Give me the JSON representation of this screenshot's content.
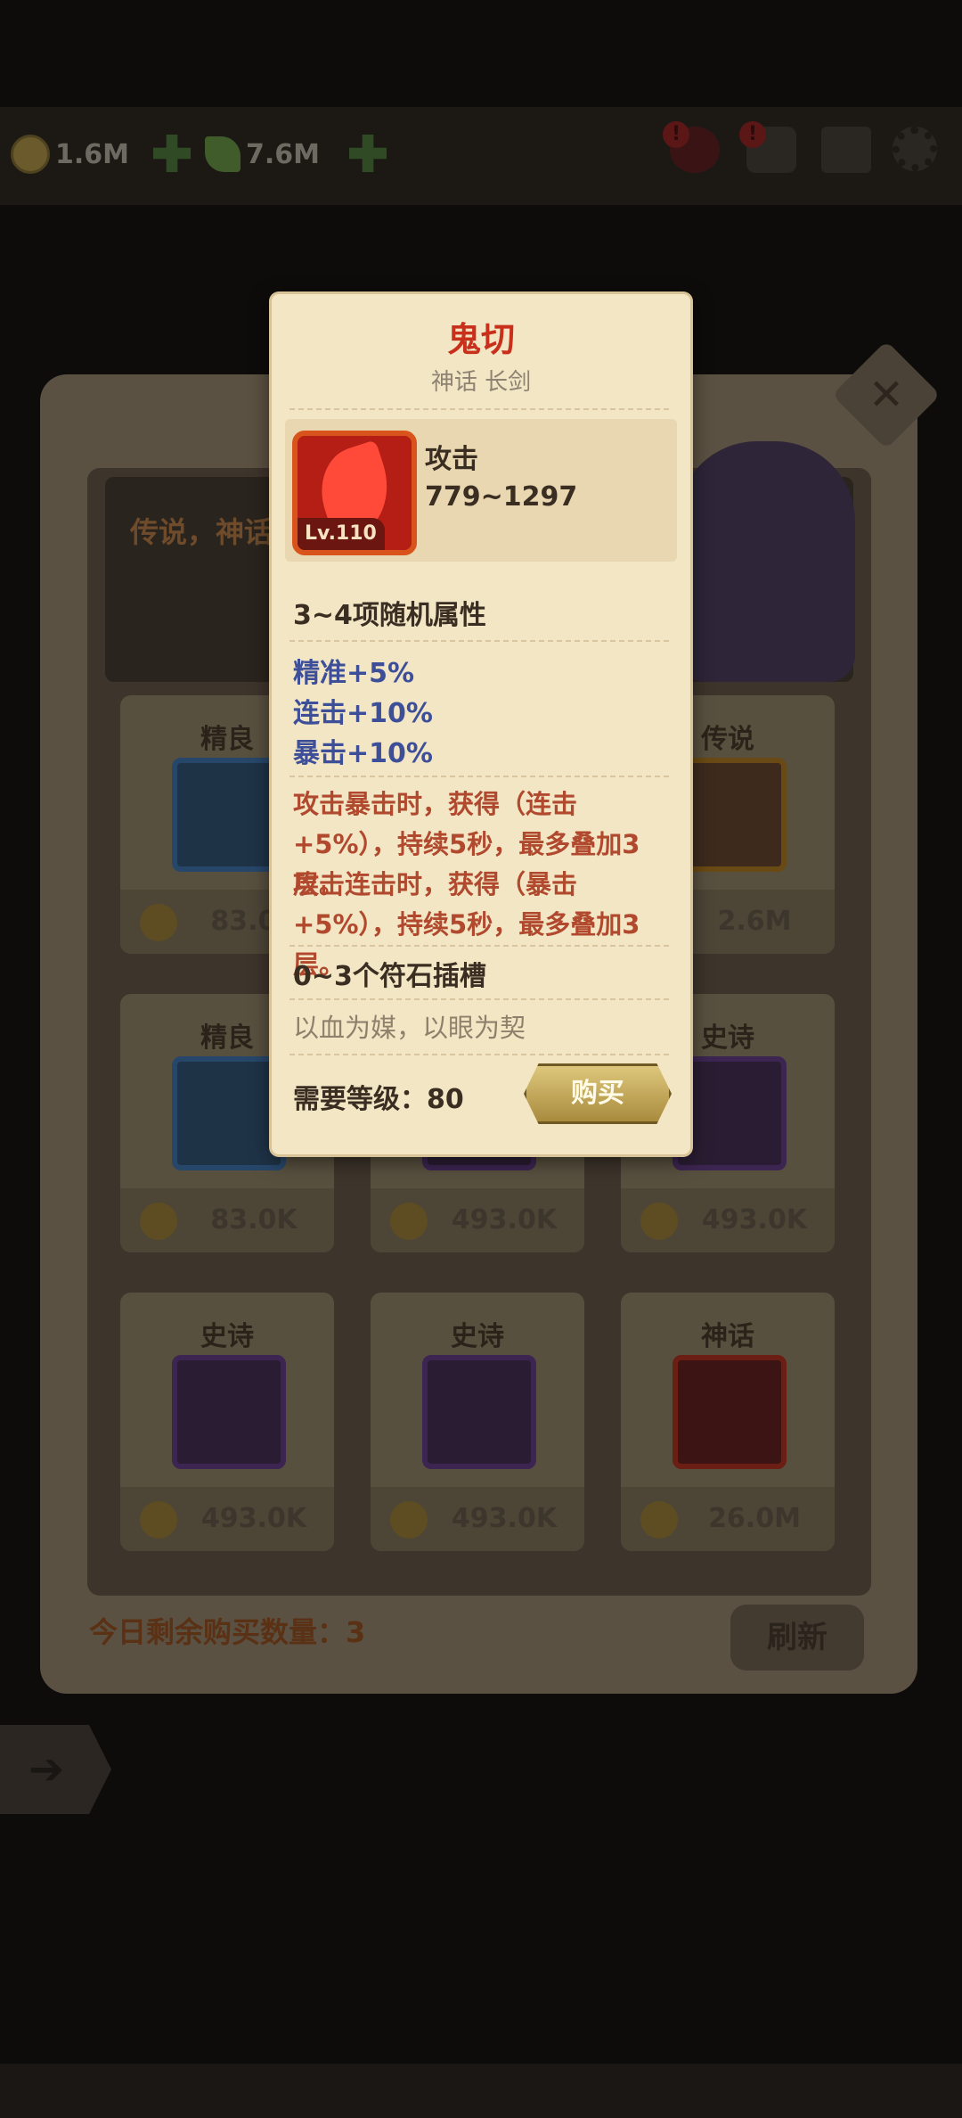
{
  "topbar": {
    "gold_amount": "1.6M",
    "gem_amount": "7.6M",
    "alert_marks": [
      "!",
      "!"
    ]
  },
  "shop": {
    "banner_text": "传说，神话",
    "close_icon_glyph": "✕",
    "items": [
      {
        "tier": "精良",
        "price": "83.0K",
        "rarity": "blue"
      },
      {
        "tier": "传说",
        "price": "2.6M",
        "rarity": "orange"
      },
      {
        "tier": "精良",
        "price": "83.0K",
        "rarity": "blue"
      },
      {
        "tier": "",
        "price": "493.0K",
        "rarity": "purple"
      },
      {
        "tier": "史诗",
        "price": "493.0K",
        "rarity": "purple"
      },
      {
        "tier": "史诗",
        "price": "493.0K",
        "rarity": "purple"
      },
      {
        "tier": "史诗",
        "price": "493.0K",
        "rarity": "purple"
      },
      {
        "tier": "神话",
        "price": "26.0M",
        "rarity": "red"
      }
    ],
    "remaining_label": "今日剩余购买数量：3",
    "refresh_label": "刷新"
  },
  "popup": {
    "title": "鬼切",
    "subtitle": "神话 长剑",
    "level_badge": "Lv.110",
    "stat_name": "攻击",
    "stat_value": "779~1297",
    "random_attr_header": "3~4项随机属性",
    "attributes": [
      "精准+5%",
      "连击+10%",
      "暴击+10%"
    ],
    "effects": [
      "攻击暴击时，获得（连击+5%），持续5秒，最多叠加3层。",
      "攻击连击时，获得（暴击+5%），持续5秒，最多叠加3层。"
    ],
    "rune_slots": "0~3个符石插槽",
    "flavor": "以血为媒，以眼为契",
    "level_requirement": "需要等级：80",
    "buy_label": "购买"
  },
  "colors": {
    "mythic_red": "#c8301c",
    "attribute_blue": "#3d4f98",
    "effect_red": "#b0492e",
    "parchment": "#f3e6c5"
  }
}
